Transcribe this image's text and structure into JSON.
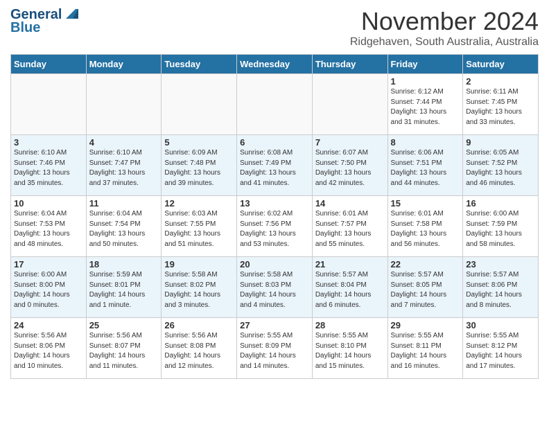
{
  "header": {
    "logo_line1": "General",
    "logo_line2": "Blue",
    "month": "November 2024",
    "location": "Ridgehaven, South Australia, Australia"
  },
  "days_of_week": [
    "Sunday",
    "Monday",
    "Tuesday",
    "Wednesday",
    "Thursday",
    "Friday",
    "Saturday"
  ],
  "weeks": [
    [
      {
        "day": "",
        "info": ""
      },
      {
        "day": "",
        "info": ""
      },
      {
        "day": "",
        "info": ""
      },
      {
        "day": "",
        "info": ""
      },
      {
        "day": "",
        "info": ""
      },
      {
        "day": "1",
        "info": "Sunrise: 6:12 AM\nSunset: 7:44 PM\nDaylight: 13 hours\nand 31 minutes."
      },
      {
        "day": "2",
        "info": "Sunrise: 6:11 AM\nSunset: 7:45 PM\nDaylight: 13 hours\nand 33 minutes."
      }
    ],
    [
      {
        "day": "3",
        "info": "Sunrise: 6:10 AM\nSunset: 7:46 PM\nDaylight: 13 hours\nand 35 minutes."
      },
      {
        "day": "4",
        "info": "Sunrise: 6:10 AM\nSunset: 7:47 PM\nDaylight: 13 hours\nand 37 minutes."
      },
      {
        "day": "5",
        "info": "Sunrise: 6:09 AM\nSunset: 7:48 PM\nDaylight: 13 hours\nand 39 minutes."
      },
      {
        "day": "6",
        "info": "Sunrise: 6:08 AM\nSunset: 7:49 PM\nDaylight: 13 hours\nand 41 minutes."
      },
      {
        "day": "7",
        "info": "Sunrise: 6:07 AM\nSunset: 7:50 PM\nDaylight: 13 hours\nand 42 minutes."
      },
      {
        "day": "8",
        "info": "Sunrise: 6:06 AM\nSunset: 7:51 PM\nDaylight: 13 hours\nand 44 minutes."
      },
      {
        "day": "9",
        "info": "Sunrise: 6:05 AM\nSunset: 7:52 PM\nDaylight: 13 hours\nand 46 minutes."
      }
    ],
    [
      {
        "day": "10",
        "info": "Sunrise: 6:04 AM\nSunset: 7:53 PM\nDaylight: 13 hours\nand 48 minutes."
      },
      {
        "day": "11",
        "info": "Sunrise: 6:04 AM\nSunset: 7:54 PM\nDaylight: 13 hours\nand 50 minutes."
      },
      {
        "day": "12",
        "info": "Sunrise: 6:03 AM\nSunset: 7:55 PM\nDaylight: 13 hours\nand 51 minutes."
      },
      {
        "day": "13",
        "info": "Sunrise: 6:02 AM\nSunset: 7:56 PM\nDaylight: 13 hours\nand 53 minutes."
      },
      {
        "day": "14",
        "info": "Sunrise: 6:01 AM\nSunset: 7:57 PM\nDaylight: 13 hours\nand 55 minutes."
      },
      {
        "day": "15",
        "info": "Sunrise: 6:01 AM\nSunset: 7:58 PM\nDaylight: 13 hours\nand 56 minutes."
      },
      {
        "day": "16",
        "info": "Sunrise: 6:00 AM\nSunset: 7:59 PM\nDaylight: 13 hours\nand 58 minutes."
      }
    ],
    [
      {
        "day": "17",
        "info": "Sunrise: 6:00 AM\nSunset: 8:00 PM\nDaylight: 14 hours\nand 0 minutes."
      },
      {
        "day": "18",
        "info": "Sunrise: 5:59 AM\nSunset: 8:01 PM\nDaylight: 14 hours\nand 1 minute."
      },
      {
        "day": "19",
        "info": "Sunrise: 5:58 AM\nSunset: 8:02 PM\nDaylight: 14 hours\nand 3 minutes."
      },
      {
        "day": "20",
        "info": "Sunrise: 5:58 AM\nSunset: 8:03 PM\nDaylight: 14 hours\nand 4 minutes."
      },
      {
        "day": "21",
        "info": "Sunrise: 5:57 AM\nSunset: 8:04 PM\nDaylight: 14 hours\nand 6 minutes."
      },
      {
        "day": "22",
        "info": "Sunrise: 5:57 AM\nSunset: 8:05 PM\nDaylight: 14 hours\nand 7 minutes."
      },
      {
        "day": "23",
        "info": "Sunrise: 5:57 AM\nSunset: 8:06 PM\nDaylight: 14 hours\nand 8 minutes."
      }
    ],
    [
      {
        "day": "24",
        "info": "Sunrise: 5:56 AM\nSunset: 8:06 PM\nDaylight: 14 hours\nand 10 minutes."
      },
      {
        "day": "25",
        "info": "Sunrise: 5:56 AM\nSunset: 8:07 PM\nDaylight: 14 hours\nand 11 minutes."
      },
      {
        "day": "26",
        "info": "Sunrise: 5:56 AM\nSunset: 8:08 PM\nDaylight: 14 hours\nand 12 minutes."
      },
      {
        "day": "27",
        "info": "Sunrise: 5:55 AM\nSunset: 8:09 PM\nDaylight: 14 hours\nand 14 minutes."
      },
      {
        "day": "28",
        "info": "Sunrise: 5:55 AM\nSunset: 8:10 PM\nDaylight: 14 hours\nand 15 minutes."
      },
      {
        "day": "29",
        "info": "Sunrise: 5:55 AM\nSunset: 8:11 PM\nDaylight: 14 hours\nand 16 minutes."
      },
      {
        "day": "30",
        "info": "Sunrise: 5:55 AM\nSunset: 8:12 PM\nDaylight: 14 hours\nand 17 minutes."
      }
    ]
  ]
}
